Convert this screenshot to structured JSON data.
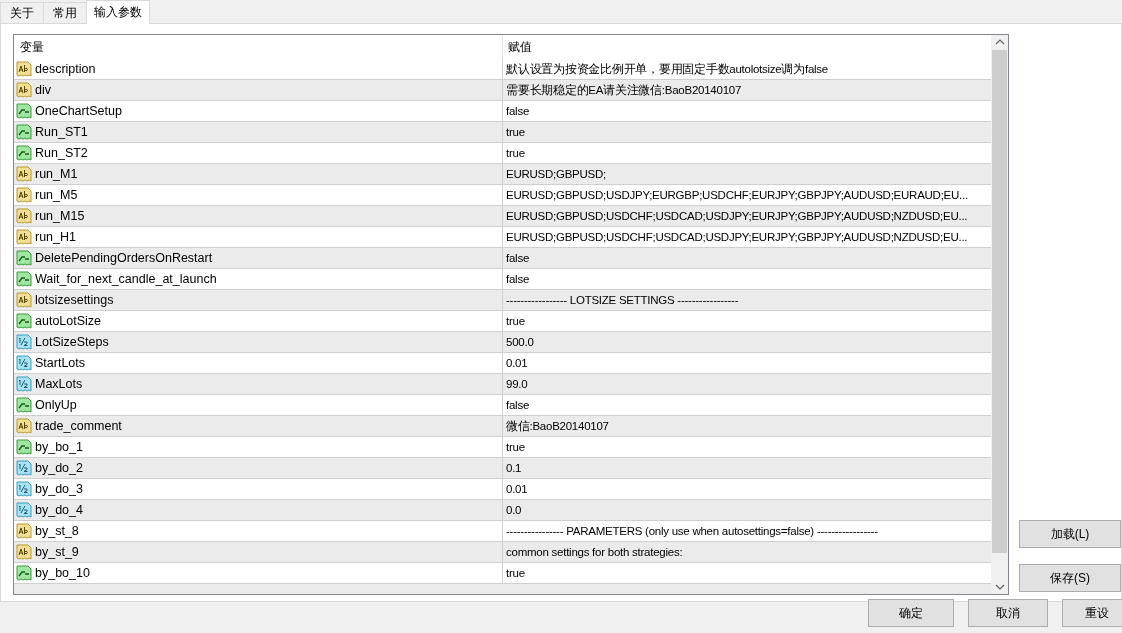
{
  "tabs": [
    {
      "label": "关于",
      "selected": false
    },
    {
      "label": "常用",
      "selected": false
    },
    {
      "label": "输入参数",
      "selected": true
    }
  ],
  "table": {
    "columns": [
      "变量",
      "赋值"
    ],
    "rows": [
      {
        "kind": "string",
        "name": "description",
        "value": "默认设置为按资金比例开单，要用固定手数autolotsize调为false"
      },
      {
        "kind": "string",
        "name": "div",
        "value": "需要长期稳定的EA请关注微信:BaoB20140107"
      },
      {
        "kind": "bool",
        "name": "OneChartSetup",
        "value": "false"
      },
      {
        "kind": "bool",
        "name": "Run_ST1",
        "value": "true"
      },
      {
        "kind": "bool",
        "name": "Run_ST2",
        "value": "true"
      },
      {
        "kind": "string",
        "name": "run_M1",
        "value": "EURUSD;GBPUSD;"
      },
      {
        "kind": "string",
        "name": "run_M5",
        "value": "EURUSD;GBPUSD;USDJPY;EURGBP;USDCHF;EURJPY;GBPJPY;AUDUSD;EURAUD;EU..."
      },
      {
        "kind": "string",
        "name": "run_M15",
        "value": "EURUSD;GBPUSD;USDCHF;USDCAD;USDJPY;EURJPY;GBPJPY;AUDUSD;NZDUSD;EU..."
      },
      {
        "kind": "string",
        "name": "run_H1",
        "value": "EURUSD;GBPUSD;USDCHF;USDCAD;USDJPY;EURJPY;GBPJPY;AUDUSD;NZDUSD;EU..."
      },
      {
        "kind": "bool",
        "name": "DeletePendingOrdersOnRestart",
        "value": "false"
      },
      {
        "kind": "bool",
        "name": "Wait_for_next_candle_at_launch",
        "value": "false"
      },
      {
        "kind": "string",
        "name": "lotsizesettings",
        "value": "----------------- LOTSIZE SETTINGS -----------------"
      },
      {
        "kind": "bool",
        "name": "autoLotSize",
        "value": "true"
      },
      {
        "kind": "double",
        "name": "LotSizeSteps",
        "value": "500.0"
      },
      {
        "kind": "double",
        "name": "StartLots",
        "value": "0.01"
      },
      {
        "kind": "double",
        "name": "MaxLots",
        "value": "99.0"
      },
      {
        "kind": "bool",
        "name": "OnlyUp",
        "value": "false"
      },
      {
        "kind": "string",
        "name": "trade_comment",
        "value": "微信:BaoB20140107"
      },
      {
        "kind": "bool",
        "name": "by_bo_1",
        "value": "true"
      },
      {
        "kind": "double",
        "name": "by_do_2",
        "value": "0.1"
      },
      {
        "kind": "double",
        "name": "by_do_3",
        "value": "0.01"
      },
      {
        "kind": "double",
        "name": "by_do_4",
        "value": "0.0"
      },
      {
        "kind": "string",
        "name": "by_st_8",
        "value": "---------------- PARAMETERS (only use when autosettings=false) -----------------"
      },
      {
        "kind": "string",
        "name": "by_st_9",
        "value": "common settings for both strategies:"
      },
      {
        "kind": "bool",
        "name": "by_bo_10",
        "value": "true"
      }
    ]
  },
  "side_buttons": [
    "加载(L)",
    "保存(S)"
  ],
  "buttons": [
    "确定",
    "取消",
    "重设"
  ]
}
